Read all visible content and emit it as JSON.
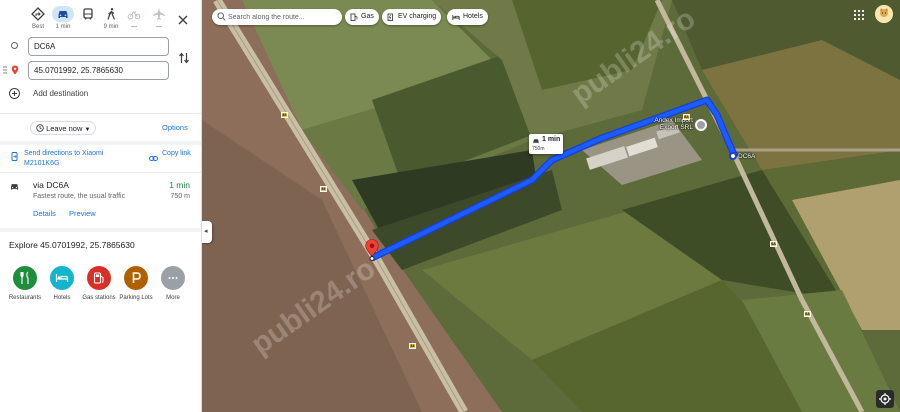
{
  "travel_modes": [
    {
      "name": "Best",
      "label": "Best",
      "icon": "diamond-turn-icon"
    },
    {
      "name": "Driving",
      "label": "1 min",
      "icon": "car-icon"
    },
    {
      "name": "Transit",
      "label": "",
      "icon": "bus-icon"
    },
    {
      "name": "Walking",
      "label": "9 min",
      "icon": "walk-icon"
    },
    {
      "name": "Cycling",
      "label": "—",
      "icon": "bike-icon"
    },
    {
      "name": "Flight",
      "label": "—",
      "icon": "plane-icon"
    }
  ],
  "directions": {
    "origin_value": "DC6A",
    "destination_value": "45.0701992, 25.7865630",
    "add_destination": "Add destination",
    "leave_now": "Leave now",
    "options": "Options",
    "send_directions": "Send directions to Xiaomi M2101K6G",
    "copy_link": "Copy link"
  },
  "route": {
    "via": "via DC6A",
    "description": "Fastest route, the usual traffic",
    "time": "1 min",
    "distance": "750 m",
    "details": "Details",
    "preview": "Preview"
  },
  "explore": {
    "title": "Explore 45.0701992, 25.7865630",
    "categories": [
      {
        "label": "Restaurants",
        "color": "#1e8e3e",
        "icon": "fork-knife-icon"
      },
      {
        "label": "Hotels",
        "color": "#12b5cb",
        "icon": "bed-icon"
      },
      {
        "label": "Gas stations",
        "color": "#d93025",
        "icon": "gas-pump-icon"
      },
      {
        "label": "Parking Lots",
        "color": "#b06000",
        "icon": "parking-icon"
      },
      {
        "label": "More",
        "color": "#9aa0a6",
        "icon": "more-dots-icon"
      }
    ]
  },
  "map": {
    "search_placeholder": "Search along the route...",
    "chips": [
      "Gas",
      "EV charging",
      "Hotels"
    ],
    "route_bubble_time": "1 min",
    "route_bubble_distance": "750m",
    "place_label": "Andex Import Export SRL",
    "road_label": "DC6A",
    "road_badges": [
      "84",
      "6A"
    ],
    "watermark": "publi24.ro",
    "colors": {
      "route": "#1a5cff",
      "accent": "#1a73e8",
      "pin": "#ea4335"
    }
  }
}
